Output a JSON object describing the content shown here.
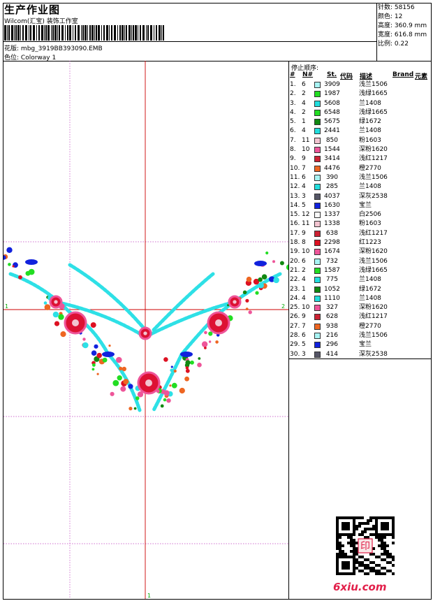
{
  "header": {
    "title": "生产作业图",
    "company": "Wilcom(汇宝) 装饰工作室",
    "design_label": "花版:",
    "design_file": "mbg_3919BB393090.EMB",
    "colorway_label": "色位:",
    "colorway": "Colorway 1"
  },
  "stats": [
    {
      "label": "针数:",
      "value": "58156"
    },
    {
      "label": "颜色:",
      "value": "12"
    },
    {
      "label": "高度:",
      "value": "360.9 mm"
    },
    {
      "label": "宽度:",
      "value": "616.8 mm"
    },
    {
      "label": "比例:",
      "value": "0.22"
    }
  ],
  "sequence": {
    "label": "停止顺序:",
    "headers": [
      "#",
      "N#",
      "St.",
      "代码",
      "描述",
      "Brand",
      "元素"
    ],
    "rows": [
      {
        "n": "1.",
        "c": "6",
        "st": "3909",
        "desc": "浅兰1506",
        "color": "#a8f4f4"
      },
      {
        "n": "2.",
        "c": "2",
        "st": "1987",
        "desc": "浅绿1665",
        "color": "#22dd22"
      },
      {
        "n": "3.",
        "c": "4",
        "st": "5608",
        "desc": "兰1408",
        "color": "#22dddd"
      },
      {
        "n": "4.",
        "c": "2",
        "st": "6548",
        "desc": "浅绿1665",
        "color": "#22dd22"
      },
      {
        "n": "5.",
        "c": "1",
        "st": "5675",
        "desc": "绿1672",
        "color": "#118811"
      },
      {
        "n": "6.",
        "c": "4",
        "st": "2441",
        "desc": "兰1408",
        "color": "#22dddd"
      },
      {
        "n": "7.",
        "c": "11",
        "st": "850",
        "desc": "粉1603",
        "color": "#f2c4d0"
      },
      {
        "n": "8.",
        "c": "10",
        "st": "1544",
        "desc": "深粉1620",
        "color": "#ee5599"
      },
      {
        "n": "9.",
        "c": "9",
        "st": "3414",
        "desc": "浅红1217",
        "color": "#cc2233"
      },
      {
        "n": "10.",
        "c": "7",
        "st": "4476",
        "desc": "橙2770",
        "color": "#ee6622"
      },
      {
        "n": "11.",
        "c": "6",
        "st": "390",
        "desc": "浅兰1506",
        "color": "#a8f4f4"
      },
      {
        "n": "12.",
        "c": "4",
        "st": "285",
        "desc": "兰1408",
        "color": "#22dddd"
      },
      {
        "n": "13.",
        "c": "3",
        "st": "4037",
        "desc": "深灰2538",
        "color": "#555566"
      },
      {
        "n": "14.",
        "c": "5",
        "st": "1630",
        "desc": "宝兰",
        "color": "#1122dd"
      },
      {
        "n": "15.",
        "c": "12",
        "st": "1337",
        "desc": "白2506",
        "color": "#fafafa"
      },
      {
        "n": "16.",
        "c": "11",
        "st": "1338",
        "desc": "粉1603",
        "color": "#f2c4d0"
      },
      {
        "n": "17.",
        "c": "9",
        "st": "638",
        "desc": "浅红1217",
        "color": "#cc2233"
      },
      {
        "n": "18.",
        "c": "8",
        "st": "2298",
        "desc": "红1223",
        "color": "#dd1122"
      },
      {
        "n": "19.",
        "c": "10",
        "st": "1674",
        "desc": "深粉1620",
        "color": "#ee5599"
      },
      {
        "n": "20.",
        "c": "6",
        "st": "732",
        "desc": "浅兰1506",
        "color": "#a8f4f4"
      },
      {
        "n": "21.",
        "c": "2",
        "st": "1587",
        "desc": "浅绿1665",
        "color": "#22dd22"
      },
      {
        "n": "22.",
        "c": "4",
        "st": "775",
        "desc": "兰1408",
        "color": "#22dddd"
      },
      {
        "n": "23.",
        "c": "1",
        "st": "1052",
        "desc": "绿1672",
        "color": "#118811"
      },
      {
        "n": "24.",
        "c": "4",
        "st": "1110",
        "desc": "兰1408",
        "color": "#22dddd"
      },
      {
        "n": "25.",
        "c": "10",
        "st": "327",
        "desc": "深粉1620",
        "color": "#ee5599"
      },
      {
        "n": "26.",
        "c": "9",
        "st": "628",
        "desc": "浅红1217",
        "color": "#cc2233"
      },
      {
        "n": "27.",
        "c": "7",
        "st": "938",
        "desc": "橙2770",
        "color": "#ee6622"
      },
      {
        "n": "28.",
        "c": "6",
        "st": "216",
        "desc": "浅兰1506",
        "color": "#a8f4f4"
      },
      {
        "n": "29.",
        "c": "5",
        "st": "296",
        "desc": "宝兰",
        "color": "#1122dd"
      },
      {
        "n": "30.",
        "c": "3",
        "st": "414",
        "desc": "深灰2538",
        "color": "#555566"
      }
    ]
  },
  "markers": {
    "left": "1",
    "right": "2",
    "bottom": "1"
  },
  "logo": "6xiu.com",
  "qr_stamp": "印"
}
